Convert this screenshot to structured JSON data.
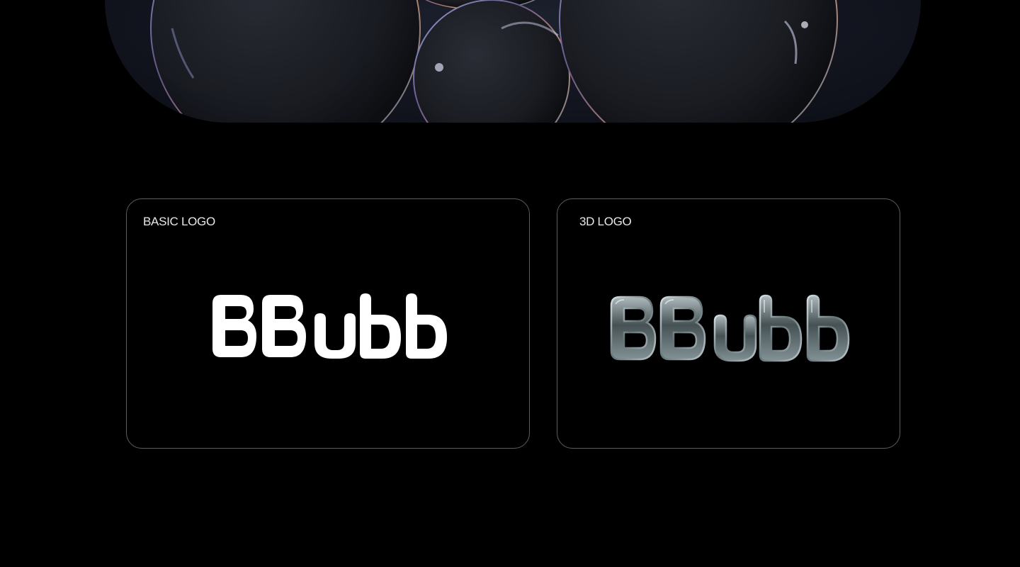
{
  "hero": {
    "image_icon": "soap-bubbles-image"
  },
  "cards": [
    {
      "label": "BASIC LOGO",
      "logo_icon": "bbubb-wordmark-flat"
    },
    {
      "label": "3D LOGO",
      "logo_icon": "bbubb-wordmark-glass"
    }
  ],
  "colors": {
    "background": "#000000",
    "card_border": "#5d5d5f",
    "label_text": "#e8e8e8",
    "logo_fill": "#ffffff"
  }
}
